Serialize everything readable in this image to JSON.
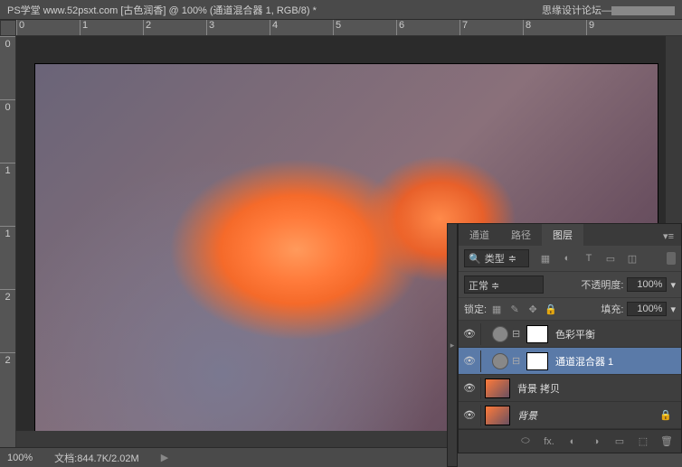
{
  "titlebar": {
    "text": "PS学堂  www.52psxt.com [古色润香] @ 100% (通道混合器 1, RGB/8) *"
  },
  "watermark": {
    "text": "思缘设计论坛—"
  },
  "ruler": {
    "h": [
      "0",
      "1",
      "2",
      "3",
      "4",
      "5",
      "6",
      "7",
      "8",
      "9"
    ],
    "v": [
      "0",
      "0",
      "1",
      "1",
      "2",
      "2"
    ]
  },
  "statusbar": {
    "zoom": "100%",
    "doc_label": "文档:",
    "doc_info": "844.7K/2.02M",
    "arrow": "▶"
  },
  "layers_panel": {
    "tabs": {
      "channels": "通道",
      "paths": "路径",
      "layers": "图层"
    },
    "filter_label": "类型",
    "filter_icons": {
      "img": "▦",
      "adj": "◐",
      "text": "T",
      "shape": "▭",
      "smart": "◫"
    },
    "blend_mode": "正常",
    "opacity_label": "不透明度:",
    "opacity_value": "100%",
    "lock_label": "锁定:",
    "fill_label": "填充:",
    "fill_value": "100%",
    "lock_icons": {
      "pix": "▦",
      "pos": "✥",
      "brush": "✎",
      "all": "🔒"
    },
    "layers": [
      {
        "name": "色彩平衡",
        "type": "adj"
      },
      {
        "name": "通道混合器 1",
        "type": "adj",
        "selected": true
      },
      {
        "name": "背景 拷贝",
        "type": "img"
      },
      {
        "name": "背景",
        "type": "bg",
        "locked": true
      }
    ],
    "footer_icons": {
      "link": "⬭",
      "fx": "fx.",
      "mask": "◐",
      "adj": "◑",
      "group": "▭",
      "new": "⬚",
      "trash": "🗑"
    }
  }
}
